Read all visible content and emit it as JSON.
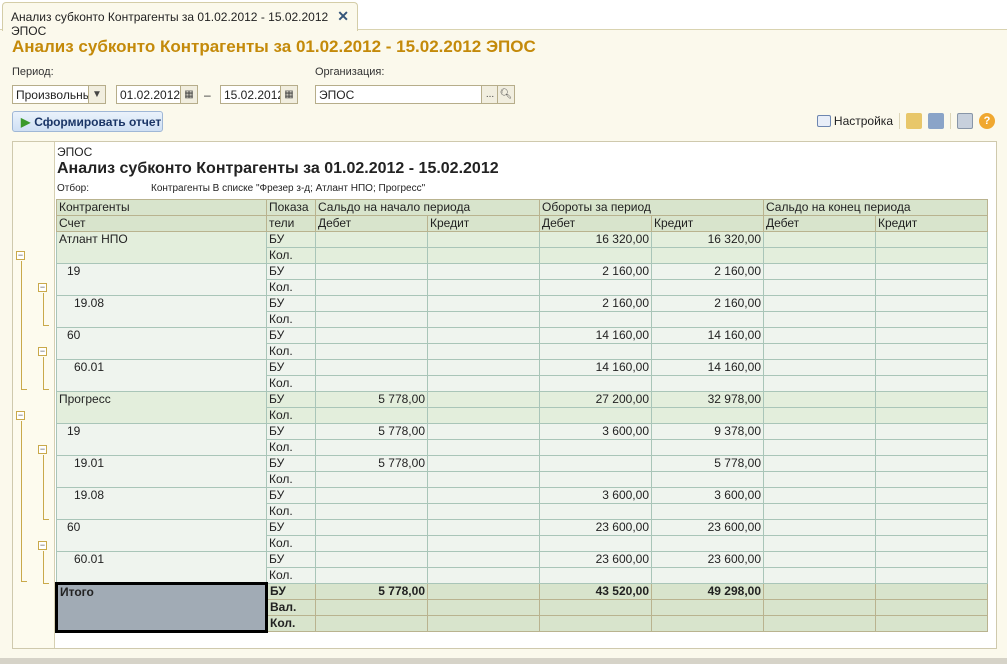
{
  "tab": {
    "label": "Анализ субконто Контрагенты за 01.02.2012 - 15.02.2012 ЭПОС",
    "close": "✕"
  },
  "title": "Анализ субконто Контрагенты за 01.02.2012 - 15.02.2012 ЭПОС",
  "form": {
    "period_label": "Период:",
    "period_type": "Произвольный",
    "date_from": "01.02.2012",
    "dash": "–",
    "date_to": "15.02.2012",
    "org_label": "Организация:",
    "org_value": "ЭПОС",
    "org_select": "...",
    "generate": "Сформировать отчет"
  },
  "toolbar": {
    "settings": "Настройка"
  },
  "report": {
    "org": "ЭПОС",
    "title": "Анализ субконто Контрагенты за 01.02.2012 - 15.02.2012",
    "filter_label": "Отбор:",
    "filter_value": "Контрагенты В списке \"Фрезер з-д; Атлант НПО; Прогресс\"",
    "headers": {
      "c1a": "Контрагенты",
      "c1b": "Счет",
      "c2a": "Показа",
      "c2b": "тели",
      "g1": "Сальдо на начало периода",
      "g2": "Обороты за период",
      "g3": "Сальдо на конец периода",
      "debit": "Дебет",
      "credit": "Кредит"
    },
    "rows": [
      {
        "name": "Атлант НПО",
        "level": 1,
        "values": [
          "",
          "",
          "16 320,00",
          "16 320,00",
          "",
          ""
        ]
      },
      {
        "name": "19",
        "level": 2,
        "values": [
          "",
          "",
          "2 160,00",
          "2 160,00",
          "",
          ""
        ]
      },
      {
        "name": "19.08",
        "level": 3,
        "values": [
          "",
          "",
          "2 160,00",
          "2 160,00",
          "",
          ""
        ]
      },
      {
        "name": "60",
        "level": 2,
        "values": [
          "",
          "",
          "14 160,00",
          "14 160,00",
          "",
          ""
        ]
      },
      {
        "name": "60.01",
        "level": 3,
        "values": [
          "",
          "",
          "14 160,00",
          "14 160,00",
          "",
          ""
        ]
      },
      {
        "name": "Прогресс",
        "level": 1,
        "values": [
          "5 778,00",
          "",
          "27 200,00",
          "32 978,00",
          "",
          ""
        ]
      },
      {
        "name": "19",
        "level": 2,
        "values": [
          "5 778,00",
          "",
          "3 600,00",
          "9 378,00",
          "",
          ""
        ]
      },
      {
        "name": "19.01",
        "level": 3,
        "values": [
          "5 778,00",
          "",
          "",
          "5 778,00",
          "",
          ""
        ]
      },
      {
        "name": "19.08",
        "level": 3,
        "values": [
          "",
          "",
          "3 600,00",
          "3 600,00",
          "",
          ""
        ]
      },
      {
        "name": "60",
        "level": 2,
        "values": [
          "",
          "",
          "23 600,00",
          "23 600,00",
          "",
          ""
        ]
      },
      {
        "name": "60.01",
        "level": 3,
        "values": [
          "",
          "",
          "23 600,00",
          "23 600,00",
          "",
          ""
        ]
      }
    ],
    "ind_bu": "БУ",
    "ind_kol": "Кол.",
    "total": {
      "name": "Итого",
      "indicators": [
        "БУ",
        "Вал.",
        "Кол."
      ],
      "values": [
        "5 778,00",
        "",
        "43 520,00",
        "49 298,00",
        "",
        ""
      ]
    }
  }
}
